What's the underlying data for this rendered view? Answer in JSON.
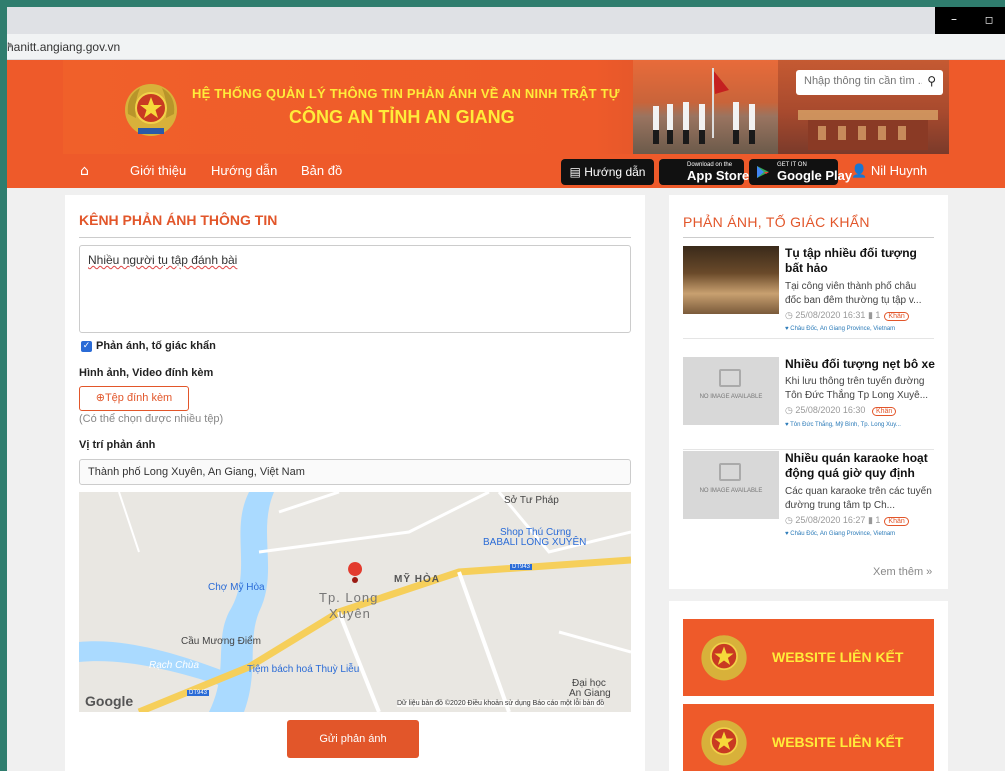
{
  "browser": {
    "url": "hanitt.angiang.gov.vn",
    "win_min": "–",
    "win_max": "◻"
  },
  "header": {
    "title_line1": "HỆ THỐNG QUẢN LÝ THÔNG TIN PHẢN ÁNH VỀ AN NINH TRẬT TỰ",
    "title_line2": "CÔNG AN TỈNH AN GIANG",
    "search_placeholder": "Nhập thông tin cần tìm ...",
    "nav": {
      "home_icon": "⌂",
      "items": [
        "Giới thiệu",
        "Hướng dẫn",
        "Bản đồ"
      ]
    },
    "guide_button": "Hướng dẫn",
    "appstore": {
      "small": "Download on the",
      "large": "App Store"
    },
    "googleplay": {
      "small": "GET IT ON",
      "large": "Google Play"
    },
    "user_name": "Nil Huynh"
  },
  "form": {
    "heading": "KÊNH PHẢN ÁNH THÔNG TIN",
    "content": "Nhiều người tụ tập đánh bài",
    "checkbox_label": "Phản ánh, tố giác khẩn",
    "checkbox_checked": true,
    "attach_label": "Hình ảnh, Video đính kèm",
    "attach_button": "⊕Tệp đính kèm",
    "attach_hint": "(Có thể chọn được nhiều tệp)",
    "location_label": "Vị trí phản ánh",
    "location_value": "Thành phố Long Xuyên, An Giang, Việt Nam",
    "submit_button": "Gửi phản ánh"
  },
  "map": {
    "labels": {
      "so_tu_phap": "Sở Tư Pháp",
      "shop": "Shop Thú Cưng",
      "shop2": "BABALI LONG XUYÊN",
      "my_hoa": "MỸ HÒA",
      "cho_my_hoa": "Chợ Mỹ Hòa",
      "tp": "Tp. Long",
      "xuyen": "Xuyên",
      "cau": "Cầu Mương Điểm",
      "tiem": "Tiệm bách hoá Thuỳ Liễu",
      "rach": "Rạch Chùa",
      "dai_hoc": "Đại học",
      "an_giang": "An Giang",
      "dt943": "DT943",
      "dt943b": "DT943",
      "google": "Google",
      "attribution": "Dữ liệu bản đồ ©2020   Điều khoản sử dụng   Báo cáo một lỗi bản đồ"
    }
  },
  "sidebar": {
    "heading": "PHẢN ÁNH, TỐ GIÁC KHẨN",
    "no_image": "NO IMAGE AVAILABLE",
    "items": [
      {
        "title": "Tụ tập nhiều đối tượng bất hảo",
        "desc": "Tại công viên thành phố châu đốc ban đêm thường tụ tập v...",
        "time": "◷ 25/08/2020 16:31",
        "comments": "▮ 1",
        "tag": "Khẩn",
        "place": "♥ Châu Đốc, An Giang Province, Vietnam"
      },
      {
        "title": "Nhiều đối tượng nẹt bô xe",
        "desc": "Khi lưu thông trên tuyến đường Tôn Đức Thắng Tp Long Xuyê...",
        "time": "◷ 25/08/2020 16:30",
        "comments": "",
        "tag": "Khẩn",
        "place": "♥ Tôn Đức Thắng, Mỹ Bình, Tp. Long Xuy..."
      },
      {
        "title": "Nhiều quán karaoke hoạt động quá giờ quy định",
        "desc": "Các quan karaoke trên các tuyến đường trung tâm tp Ch...",
        "time": "◷ 25/08/2020 16:27",
        "comments": "▮ 1",
        "tag": "Khẩn",
        "place": "♥ Châu Đốc, An Giang Province, Vietnam"
      }
    ],
    "more": "Xem thêm »",
    "links_label": "WEBSITE LIÊN KẾT"
  }
}
